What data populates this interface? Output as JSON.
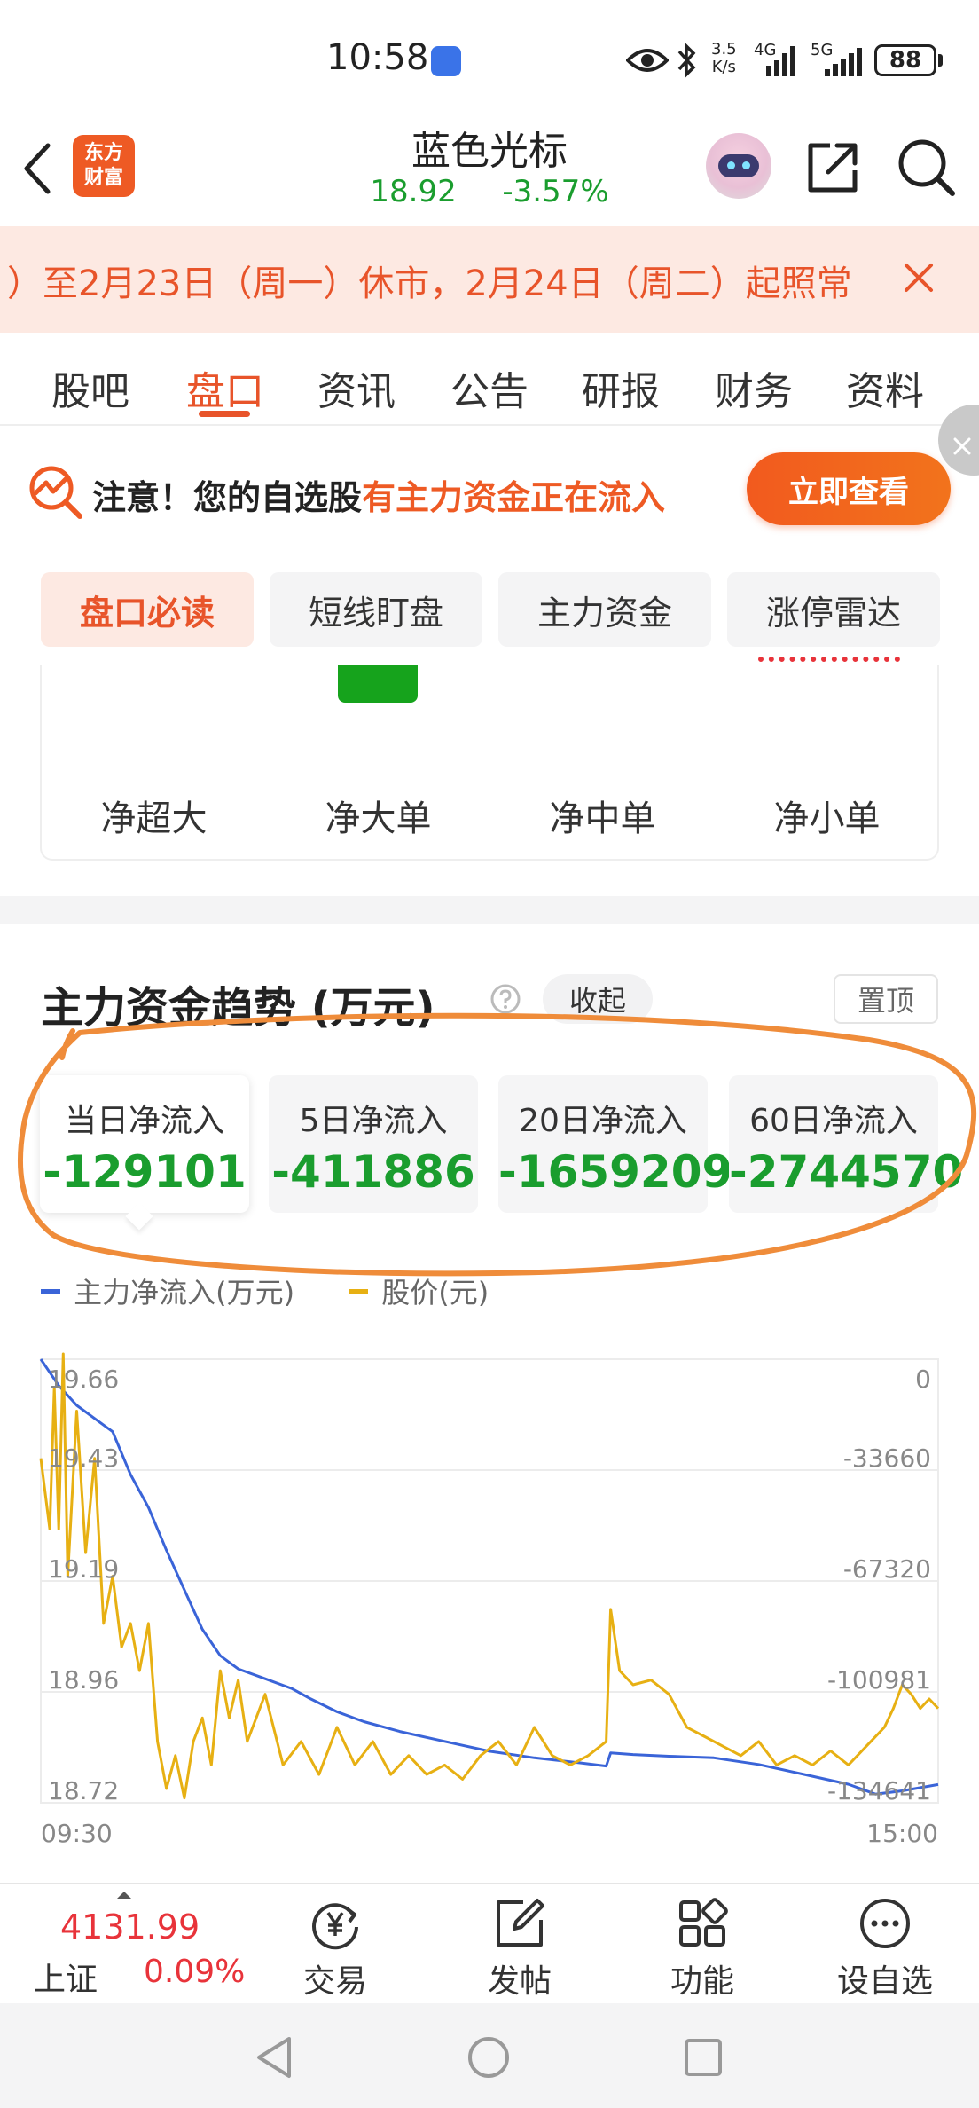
{
  "status_bar": {
    "time": "10:58",
    "net_speed_top": "3.5",
    "net_speed_unit": "K/s",
    "net1": "4G",
    "net2": "5G",
    "battery": "88"
  },
  "header": {
    "logo_line1": "东方",
    "logo_line2": "财富",
    "stock_name": "蓝色光标",
    "price": "18.92",
    "change": "-3.57%",
    "price_color": "#1a9d2e"
  },
  "notice": {
    "text": "）至2月23日（周一）休市，2月24日（周二）起照常"
  },
  "tabs": [
    "股吧",
    "盘口",
    "资讯",
    "公告",
    "研报",
    "财务",
    "资料"
  ],
  "active_tab": "盘口",
  "banner": {
    "prefix": "注意！您的自选股",
    "highlight": "有主力资金正在流入",
    "button": "立即查看"
  },
  "sub_tabs": [
    "盘口必读",
    "短线盯盘",
    "主力资金",
    "涨停雷达"
  ],
  "flow_card": {
    "labels": [
      "净超大",
      "净大单",
      "净中单",
      "净小单"
    ]
  },
  "trend": {
    "title": "主力资金趋势 (万元)",
    "collapse": "收起",
    "pin": "置顶",
    "stats": [
      {
        "label": "当日净流入",
        "value": "-129101"
      },
      {
        "label": "5日净流入",
        "value": "-411886"
      },
      {
        "label": "20日净流入",
        "value": "-1659209"
      },
      {
        "label": "60日净流入",
        "value": "-2744570"
      }
    ],
    "legend": [
      "主力净流入(万元)",
      "股价(元)"
    ]
  },
  "chart_data": {
    "type": "line",
    "x_start": "09:30",
    "x_end": "15:00",
    "left_ticks": [
      "19.66",
      "19.43",
      "19.19",
      "18.96",
      "18.72"
    ],
    "right_ticks": [
      "0",
      "-33660",
      "-67320",
      "-100981",
      "-134641"
    ],
    "y_left_range": [
      18.72,
      19.66
    ],
    "y_right_range": [
      -134641,
      0
    ],
    "series": [
      {
        "name": "主力净流入(万元)",
        "color": "#3a64d8",
        "axis": "right",
        "points": [
          [
            0,
            0
          ],
          [
            0.02,
            -8000
          ],
          [
            0.04,
            -14000
          ],
          [
            0.06,
            -18000
          ],
          [
            0.08,
            -22000
          ],
          [
            0.1,
            -35000
          ],
          [
            0.12,
            -45000
          ],
          [
            0.14,
            -58000
          ],
          [
            0.16,
            -70000
          ],
          [
            0.18,
            -82000
          ],
          [
            0.2,
            -90000
          ],
          [
            0.22,
            -94000
          ],
          [
            0.25,
            -97000
          ],
          [
            0.28,
            -100000
          ],
          [
            0.3,
            -103000
          ],
          [
            0.33,
            -107000
          ],
          [
            0.36,
            -110000
          ],
          [
            0.4,
            -113000
          ],
          [
            0.45,
            -116000
          ],
          [
            0.5,
            -119000
          ],
          [
            0.55,
            -121000
          ],
          [
            0.6,
            -122500
          ],
          [
            0.63,
            -123500
          ],
          [
            0.635,
            -119500
          ],
          [
            0.66,
            -120000
          ],
          [
            0.7,
            -120500
          ],
          [
            0.75,
            -121000
          ],
          [
            0.8,
            -123000
          ],
          [
            0.85,
            -126000
          ],
          [
            0.9,
            -129000
          ],
          [
            0.93,
            -132000
          ],
          [
            0.96,
            -131000
          ],
          [
            1.0,
            -129101
          ]
        ]
      },
      {
        "name": "股价(元)",
        "color": "#e7b013",
        "axis": "left",
        "points": [
          [
            0,
            19.45
          ],
          [
            0.01,
            19.3
          ],
          [
            0.015,
            19.6
          ],
          [
            0.02,
            19.3
          ],
          [
            0.025,
            19.7
          ],
          [
            0.03,
            19.2
          ],
          [
            0.04,
            19.55
          ],
          [
            0.05,
            19.25
          ],
          [
            0.06,
            19.45
          ],
          [
            0.07,
            19.1
          ],
          [
            0.08,
            19.2
          ],
          [
            0.09,
            19.05
          ],
          [
            0.1,
            19.1
          ],
          [
            0.11,
            19.0
          ],
          [
            0.12,
            19.1
          ],
          [
            0.13,
            18.85
          ],
          [
            0.14,
            18.75
          ],
          [
            0.15,
            18.82
          ],
          [
            0.16,
            18.73
          ],
          [
            0.17,
            18.85
          ],
          [
            0.18,
            18.9
          ],
          [
            0.19,
            18.8
          ],
          [
            0.2,
            19.0
          ],
          [
            0.21,
            18.9
          ],
          [
            0.22,
            18.98
          ],
          [
            0.23,
            18.85
          ],
          [
            0.25,
            18.95
          ],
          [
            0.27,
            18.8
          ],
          [
            0.29,
            18.85
          ],
          [
            0.31,
            18.78
          ],
          [
            0.33,
            18.88
          ],
          [
            0.35,
            18.8
          ],
          [
            0.37,
            18.85
          ],
          [
            0.39,
            18.78
          ],
          [
            0.41,
            18.82
          ],
          [
            0.43,
            18.78
          ],
          [
            0.45,
            18.8
          ],
          [
            0.47,
            18.77
          ],
          [
            0.49,
            18.82
          ],
          [
            0.51,
            18.85
          ],
          [
            0.53,
            18.8
          ],
          [
            0.55,
            18.88
          ],
          [
            0.57,
            18.82
          ],
          [
            0.59,
            18.8
          ],
          [
            0.61,
            18.82
          ],
          [
            0.63,
            18.85
          ],
          [
            0.635,
            19.13
          ],
          [
            0.645,
            19.0
          ],
          [
            0.66,
            18.97
          ],
          [
            0.68,
            18.98
          ],
          [
            0.7,
            18.95
          ],
          [
            0.72,
            18.88
          ],
          [
            0.74,
            18.86
          ],
          [
            0.76,
            18.84
          ],
          [
            0.78,
            18.82
          ],
          [
            0.8,
            18.85
          ],
          [
            0.82,
            18.8
          ],
          [
            0.84,
            18.82
          ],
          [
            0.86,
            18.8
          ],
          [
            0.88,
            18.83
          ],
          [
            0.9,
            18.8
          ],
          [
            0.92,
            18.84
          ],
          [
            0.94,
            18.88
          ],
          [
            0.95,
            18.92
          ],
          [
            0.96,
            18.97
          ],
          [
            0.97,
            18.95
          ],
          [
            0.98,
            18.92
          ],
          [
            0.99,
            18.94
          ],
          [
            1.0,
            18.92
          ]
        ]
      }
    ]
  },
  "bottom_nav": {
    "index_value": "4131.99",
    "index_name": "上证",
    "index_change": "0.09%",
    "items": [
      "交易",
      "发帖",
      "功能",
      "设自选"
    ]
  }
}
